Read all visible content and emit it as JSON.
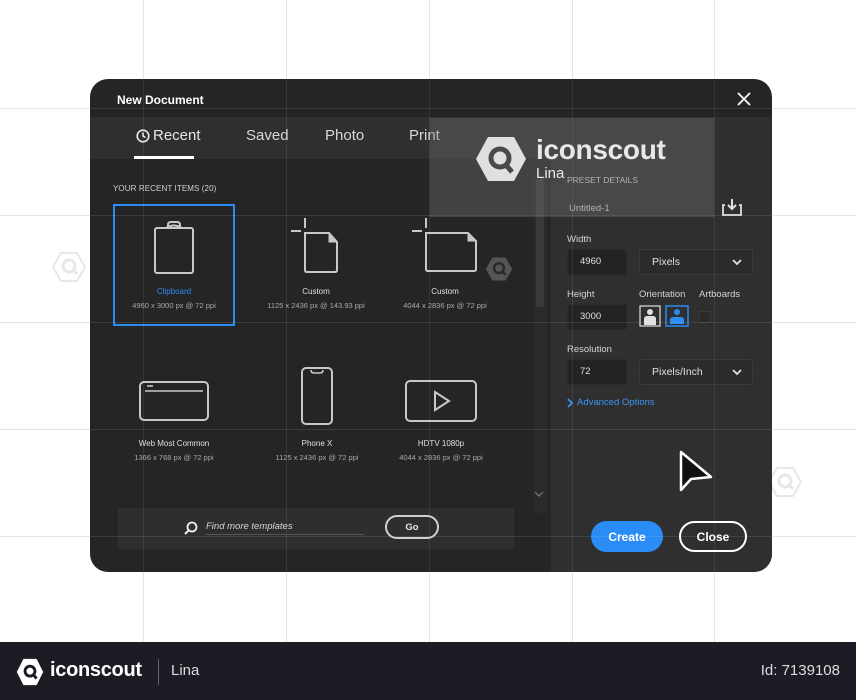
{
  "dialog": {
    "title": "New Document",
    "tabs": [
      {
        "label": "Recent",
        "active": true,
        "icon": "clock-icon"
      },
      {
        "label": "Saved",
        "active": false
      },
      {
        "label": "Photo",
        "active": false
      },
      {
        "label": "Print",
        "active": false
      }
    ],
    "section_label": "YOUR RECENT ITEMS (20)",
    "items": [
      {
        "name": "Clipboard",
        "dims": "4960 x 3000 px @ 72 ppi",
        "icon": "clipboard-icon",
        "selected": true
      },
      {
        "name": "Custom",
        "dims": "1125 x 2436 px @ 143.93 ppi",
        "icon": "portrait-document-icon",
        "selected": false
      },
      {
        "name": "Custom",
        "dims": "4044 x 2836 px @ 72 ppi",
        "icon": "landscape-document-icon",
        "selected": false
      },
      {
        "name": "Web Most Common",
        "dims": "1366 x 768 px @ 72 ppi",
        "icon": "browser-window-icon",
        "selected": false
      },
      {
        "name": "Phone X",
        "dims": "1125 x 2436 px @ 72 ppi",
        "icon": "phone-icon",
        "selected": false
      },
      {
        "name": "HDTV 1080p",
        "dims": "4044 x 2836 px @ 72 ppi",
        "icon": "video-play-icon",
        "selected": false
      }
    ],
    "search": {
      "placeholder": "Find more templates",
      "value": "",
      "go_label": "Go"
    },
    "preset": {
      "heading": "PRESET DETAILS",
      "doc_name": "Untitled-1",
      "width_label": "Width",
      "width_value": "4960",
      "width_unit": "Pixels",
      "height_label": "Height",
      "height_value": "3000",
      "orientation_label": "Orientation",
      "orientation_selected": "landscape",
      "artboards_label": "Artboards",
      "artboards_checked": false,
      "resolution_label": "Resolution",
      "resolution_value": "72",
      "resolution_unit": "Pixels/Inch",
      "advanced_label": "Advanced Options"
    },
    "buttons": {
      "create": "Create",
      "close": "Close"
    },
    "colors": {
      "accent": "#2a8cf5",
      "dialog_bg": "#252525",
      "panel_bg": "#2f2f2f"
    }
  },
  "watermark": {
    "brand": "iconscout",
    "author": "Lina"
  },
  "footer": {
    "brand": "iconscout",
    "author": "Lina",
    "id_text": "Id: 7139108"
  }
}
